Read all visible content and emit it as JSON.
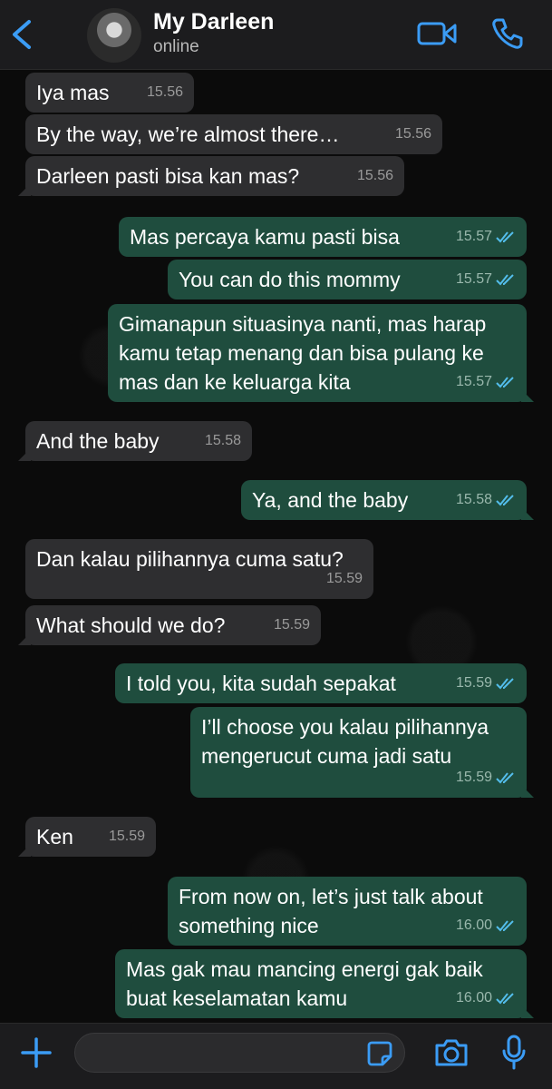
{
  "header": {
    "contact_name": "My Darleen",
    "status": "online",
    "icons": {
      "back": "chevron-left-icon",
      "video": "video-camera-icon",
      "call": "phone-icon"
    }
  },
  "colors": {
    "incoming_bubble": "#2e2e30",
    "outgoing_bubble": "#1f4d3e",
    "tick_blue": "#53bdeb",
    "accent": "#3b9cf5"
  },
  "messages": [
    {
      "dir": "in",
      "text": "Iya mas",
      "time": "15.56",
      "read": false
    },
    {
      "dir": "in",
      "text": "By the way, we’re almost there…",
      "time": "15.56",
      "read": false
    },
    {
      "dir": "in",
      "text": "Darleen pasti bisa kan mas?",
      "time": "15.56",
      "read": false
    },
    {
      "dir": "out",
      "text": "Mas percaya kamu pasti bisa",
      "time": "15.57",
      "read": true
    },
    {
      "dir": "out",
      "text": "You can do this mommy",
      "time": "15.57",
      "read": true
    },
    {
      "dir": "out",
      "lines": [
        "Gimanapun situasinya nanti, mas harap",
        "kamu tetap menang dan bisa pulang ke",
        "mas dan ke keluarga kita"
      ],
      "time": "15.57",
      "read": true
    },
    {
      "dir": "in",
      "text": "And the baby",
      "time": "15.58",
      "read": false
    },
    {
      "dir": "out",
      "text": "Ya, and the baby",
      "time": "15.58",
      "read": true
    },
    {
      "dir": "in",
      "text": "Dan kalau pilihannya cuma satu?",
      "time": "15.59",
      "read": false
    },
    {
      "dir": "in",
      "text": "What should we do?",
      "time": "15.59",
      "read": false
    },
    {
      "dir": "out",
      "text": "I told you, kita sudah sepakat",
      "time": "15.59",
      "read": true
    },
    {
      "dir": "out",
      "lines": [
        "I’ll choose you kalau pilihannya",
        "mengerucut cuma jadi satu"
      ],
      "time": "15.59",
      "read": true
    },
    {
      "dir": "in",
      "text": "Ken",
      "time": "15.59",
      "read": false
    },
    {
      "dir": "out",
      "lines": [
        "From now on, let’s just talk about",
        "something nice"
      ],
      "time": "16.00",
      "read": true
    },
    {
      "dir": "out",
      "lines": [
        "Mas gak mau mancing energi gak baik",
        "buat keselamatan kamu"
      ],
      "time": "16.00",
      "read": true
    }
  ],
  "composer": {
    "value": "",
    "icons": {
      "plus": "plus-icon",
      "sticker": "sticker-icon",
      "camera": "camera-icon",
      "mic": "microphone-icon"
    }
  }
}
